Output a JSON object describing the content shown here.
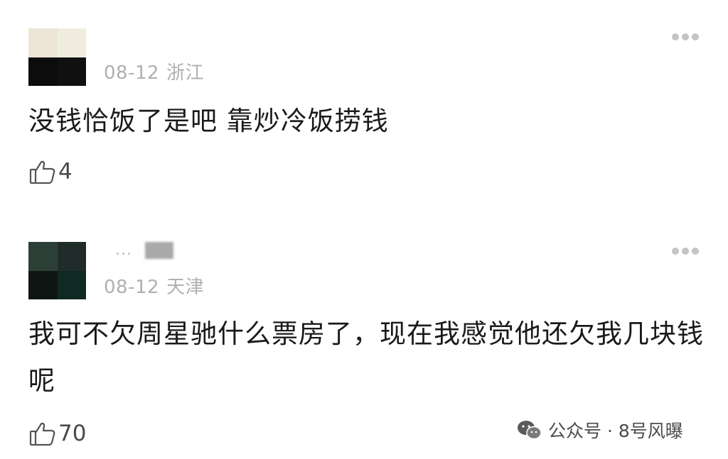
{
  "comments": [
    {
      "date": "08-12",
      "location": "浙江",
      "name_hint": "",
      "avatar_colors": [
        "#ede5d6",
        "#f0ede0",
        "#0c0c0c",
        "#101010"
      ],
      "text": "没钱恰饭了是吧 靠炒冷饭捞钱",
      "likes": "4",
      "more_icon": "more-dots-icon",
      "like_icon": "thumbs-up-icon"
    },
    {
      "date": "08-12",
      "location": "天津",
      "name_hint": "...",
      "avatar_colors": [
        "#2c3f36",
        "#1f2c2a",
        "#0f1512",
        "#0f2a22"
      ],
      "text": "我可不欠周星驰什么票房了，现在我感觉他还欠我几块钱呢",
      "likes": "70",
      "more_icon": "more-dots-icon",
      "like_icon": "thumbs-up-icon"
    }
  ],
  "watermark": {
    "icon": "wechat-icon",
    "text": "公众号 · 8号风曝"
  },
  "colors": {
    "meta_gray": "#b0b0b0",
    "text_dark": "#1a1a1a",
    "like_gray": "#4a4a4a"
  }
}
